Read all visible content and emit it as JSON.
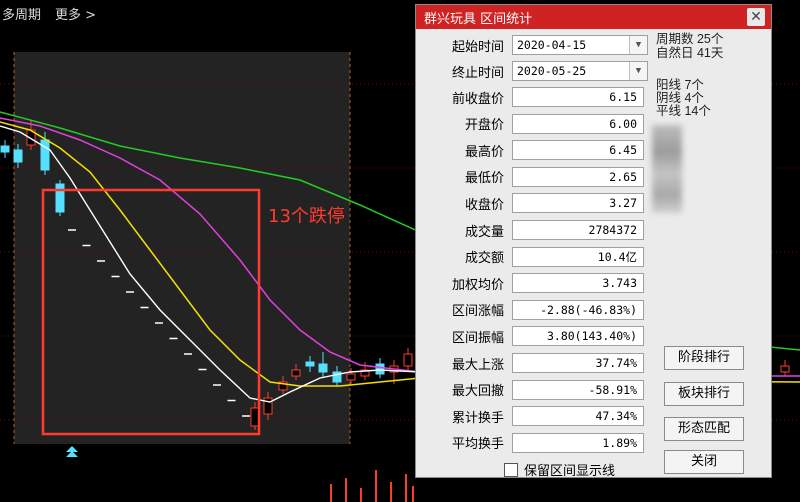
{
  "toolbar": {
    "period_label": "多周期",
    "more_label": "更多 >"
  },
  "annotation": "13个跌停",
  "dialog": {
    "title": "群兴玩具 区间统计",
    "close_icon": "close-icon",
    "start_label": "起始时间",
    "start_value": "2020-04-15",
    "end_label": "终止时间",
    "end_value": "2020-05-25",
    "fields": [
      {
        "label": "前收盘价",
        "value": "6.15"
      },
      {
        "label": "开盘价",
        "value": "6.00"
      },
      {
        "label": "最高价",
        "value": "6.45"
      },
      {
        "label": "最低价",
        "value": "2.65"
      },
      {
        "label": "收盘价",
        "value": "3.27"
      },
      {
        "label": "成交量",
        "value": "2784372"
      },
      {
        "label": "成交额",
        "value": "10.4亿"
      },
      {
        "label": "加权均价",
        "value": "3.743"
      },
      {
        "label": "区间涨幅",
        "value": "-2.88(-46.83%)"
      },
      {
        "label": "区间振幅",
        "value": "3.80(143.40%)"
      },
      {
        "label": "最大上涨",
        "value": "37.74%"
      },
      {
        "label": "最大回撤",
        "value": "-58.91%"
      },
      {
        "label": "累计换手",
        "value": "47.34%"
      },
      {
        "label": "平均换手",
        "value": "1.89%"
      }
    ],
    "stats": {
      "period_count": "周期数 25个",
      "natural_days": "自然日 41天",
      "yang": "阳线 7个",
      "yin": "阴线 4个",
      "flat": "平线 14个"
    },
    "buttons": {
      "segment_rank": "阶段排行",
      "sector_rank": "板块排行",
      "pattern_match": "形态匹配",
      "close": "关闭"
    },
    "keep_display": "保留区间显示线"
  },
  "colors": {
    "title_red": "#cf2323",
    "up": "#ff3b30",
    "down": "#55e0ff",
    "ma_white": "#ffffff",
    "ma_yellow": "#f5e000",
    "ma_magenta": "#e040e0",
    "ma_green": "#22cc22"
  }
}
